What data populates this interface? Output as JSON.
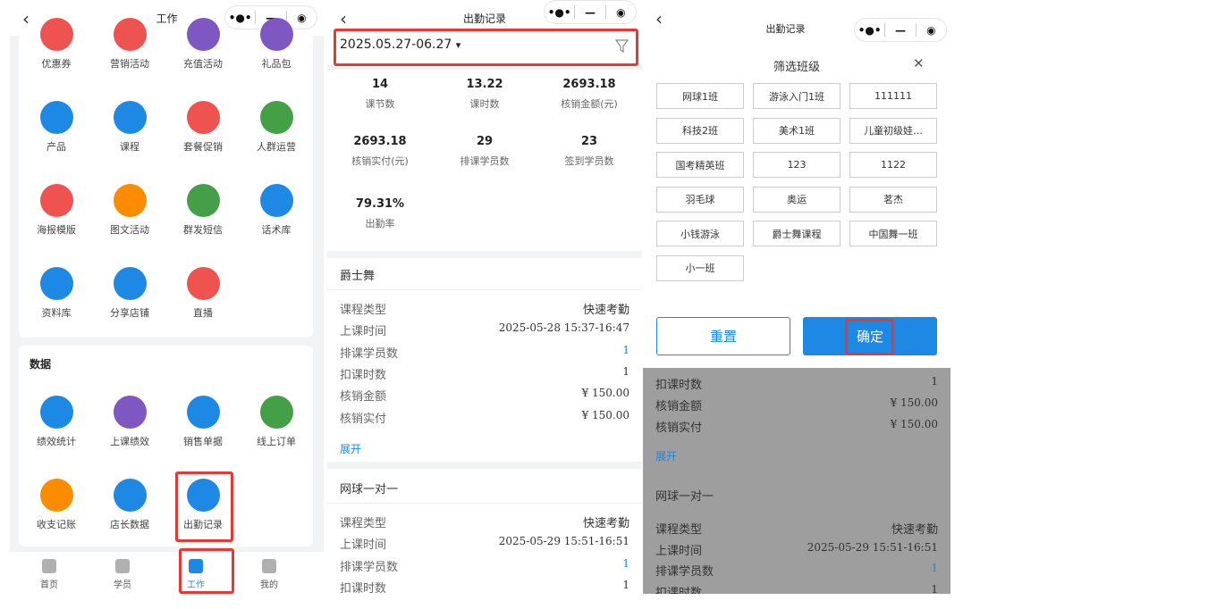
{
  "panel1": {
    "nav_title": "工作",
    "capsule": {
      "more": "•●•",
      "min": "—",
      "close": "◉"
    },
    "top_grid": [
      {
        "label": "优惠券",
        "icon": "coupon-icon",
        "color": "#ef5350"
      },
      {
        "label": "营销活动",
        "icon": "marketing-icon",
        "color": "#ef5350"
      },
      {
        "label": "充值活动",
        "icon": "recharge-icon",
        "color": "#7e57c2"
      },
      {
        "label": "礼品包",
        "icon": "gift-icon",
        "color": "#7e57c2"
      },
      {
        "label": "产品",
        "icon": "bag-icon",
        "color": "#1e88e5"
      },
      {
        "label": "课程",
        "icon": "course-icon",
        "color": "#1e88e5"
      },
      {
        "label": "套餐促销",
        "icon": "discount-icon",
        "color": "#ef5350"
      },
      {
        "label": "人群运营",
        "icon": "user-group-icon",
        "color": "#43a047"
      },
      {
        "label": "海报模版",
        "icon": "poster-icon",
        "color": "#ef5350"
      },
      {
        "label": "图文活动",
        "icon": "picture-icon",
        "color": "#fb8c00"
      },
      {
        "label": "群发短信",
        "icon": "sms-icon",
        "color": "#43a047"
      },
      {
        "label": "话术库",
        "icon": "script-library-icon",
        "color": "#1e88e5"
      },
      {
        "label": "资料库",
        "icon": "folder-icon",
        "color": "#1e88e5"
      },
      {
        "label": "分享店铺",
        "icon": "store-icon",
        "color": "#1e88e5"
      },
      {
        "label": "直播",
        "icon": "live-icon",
        "color": "#ef5350"
      }
    ],
    "data_section_title": "数据",
    "data_grid": [
      {
        "label": "绩效统计",
        "icon": "bar-chart-icon",
        "color": "#1e88e5"
      },
      {
        "label": "上课绩效",
        "icon": "class-performance-icon",
        "color": "#7e57c2"
      },
      {
        "label": "销售单据",
        "icon": "sales-doc-icon",
        "color": "#1e88e5"
      },
      {
        "label": "线上订单",
        "icon": "online-order-icon",
        "color": "#43a047"
      },
      {
        "label": "收支记账",
        "icon": "yuan-icon",
        "color": "#fb8c00"
      },
      {
        "label": "店长数据",
        "icon": "manager-data-icon",
        "color": "#1e88e5"
      },
      {
        "label": "出勤记录",
        "icon": "attendance-icon",
        "color": "#1e88e5"
      }
    ],
    "tabs": [
      {
        "label": "首页",
        "icon": "home-icon"
      },
      {
        "label": "学员",
        "icon": "student-icon"
      },
      {
        "label": "工作",
        "icon": "work-icon"
      },
      {
        "label": "我的",
        "icon": "profile-icon"
      }
    ]
  },
  "panel2": {
    "nav_title": "出勤记录",
    "date_range": "2025.05.27-06.27",
    "dropdown_arrow": "▾",
    "stats": [
      {
        "value": "14",
        "label": "课节数"
      },
      {
        "value": "13.22",
        "label": "课时数"
      },
      {
        "value": "2693.18",
        "label": "核销金额(元)"
      },
      {
        "value": "2693.18",
        "label": "核销实付(元)"
      },
      {
        "value": "29",
        "label": "排课学员数"
      },
      {
        "value": "23",
        "label": "签到学员数"
      },
      {
        "value": "79.31%",
        "label": "出勤率"
      }
    ],
    "record1": {
      "title": "爵士舞",
      "rows": [
        {
          "k": "课程类型",
          "v": "快速考勤"
        },
        {
          "k": "上课时间",
          "v": "2025-05-28 15:37-16:47"
        },
        {
          "k": "排课学员数",
          "v": "1"
        },
        {
          "k": "扣课时数",
          "v": "1"
        },
        {
          "k": "核销金额",
          "v": "¥ 150.00"
        },
        {
          "k": "核销实付",
          "v": "¥ 150.00"
        }
      ],
      "expand": "展开"
    },
    "record2": {
      "title": "网球一对一",
      "rows": [
        {
          "k": "课程类型",
          "v": "快速考勤"
        },
        {
          "k": "上课时间",
          "v": "2025-05-29 15:51-16:51"
        },
        {
          "k": "排课学员数",
          "v": "1"
        },
        {
          "k": "扣课时数",
          "v": "1"
        }
      ]
    }
  },
  "panel3": {
    "nav_title": "出勤记录",
    "filter_title": "筛选班级",
    "close": "✕",
    "chips": [
      "网球1班",
      "游泳入门1班",
      "111111",
      "科技2班",
      "美术1班",
      "儿童初级娃…",
      "国考精英班",
      "123",
      "1122",
      "羽毛球",
      "奥运",
      "茗杰",
      "小钱游泳",
      "爵士舞课程",
      "中国舞一班",
      "小一班"
    ],
    "reset": "重置",
    "confirm": "确定",
    "behind_rows": [
      {
        "k": "扣课时数",
        "v": "1"
      },
      {
        "k": "核销金额",
        "v": "¥ 150.00"
      },
      {
        "k": "核销实付",
        "v": "¥ 150.00"
      }
    ],
    "behind_expand": "展开",
    "behind_title": "网球一对一",
    "behind_rows2": [
      {
        "k": "课程类型",
        "v": "快速考勤"
      },
      {
        "k": "上课时间",
        "v": "2025-05-29 15:51-16:51"
      },
      {
        "k": "排课学员数",
        "v": "1"
      },
      {
        "k": "扣课时数",
        "v": "1"
      }
    ]
  }
}
